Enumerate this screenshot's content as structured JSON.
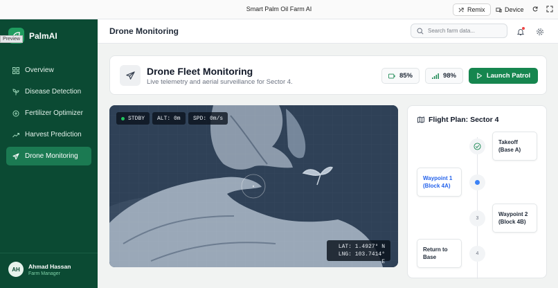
{
  "window": {
    "title": "Smart Palm Oil Farm AI",
    "remix_label": "Remix",
    "device_label": "Device"
  },
  "sidebar": {
    "brand": "PalmAI",
    "preview_label": "Preview",
    "items": [
      {
        "label": "Overview",
        "icon": "grid-icon"
      },
      {
        "label": "Disease Detection",
        "icon": "sprout-icon"
      },
      {
        "label": "Fertilizer Optimizer",
        "icon": "flask-icon"
      },
      {
        "label": "Harvest Prediction",
        "icon": "trend-icon"
      },
      {
        "label": "Drone Monitoring",
        "icon": "plane-icon",
        "active": true
      }
    ],
    "user": {
      "initials": "AH",
      "name": "Ahmad Hassan",
      "role": "Farm Manager"
    }
  },
  "header": {
    "title": "Drone Monitoring",
    "search_placeholder": "Search farm data..."
  },
  "fleet": {
    "title": "Drone Fleet Monitoring",
    "subtitle": "Live telemetry and aerial surveillance for Sector 4.",
    "battery": "85%",
    "signal": "98%",
    "launch_label": "Launch Patrol",
    "accent": "#16864f"
  },
  "feed": {
    "status": "STDBY",
    "altitude": "ALT: 0m",
    "speed": "SPD: 0m/s",
    "lat": "LAT: 1.4927° N",
    "lng": "LNG: 103.7414° E"
  },
  "flight_plan": {
    "title": "Flight Plan: Sector 4",
    "waypoints": [
      {
        "line1": "Takeoff",
        "line2": "(Base A)",
        "state": "done"
      },
      {
        "line1": "Waypoint 1",
        "line2": "(Block 4A)",
        "state": "active"
      },
      {
        "line1": "Waypoint 2",
        "line2": "(Block 4B)",
        "state": "pending",
        "number": "3"
      },
      {
        "line1": "Return to",
        "line2": "Base",
        "state": "pending",
        "number": "4"
      }
    ]
  }
}
